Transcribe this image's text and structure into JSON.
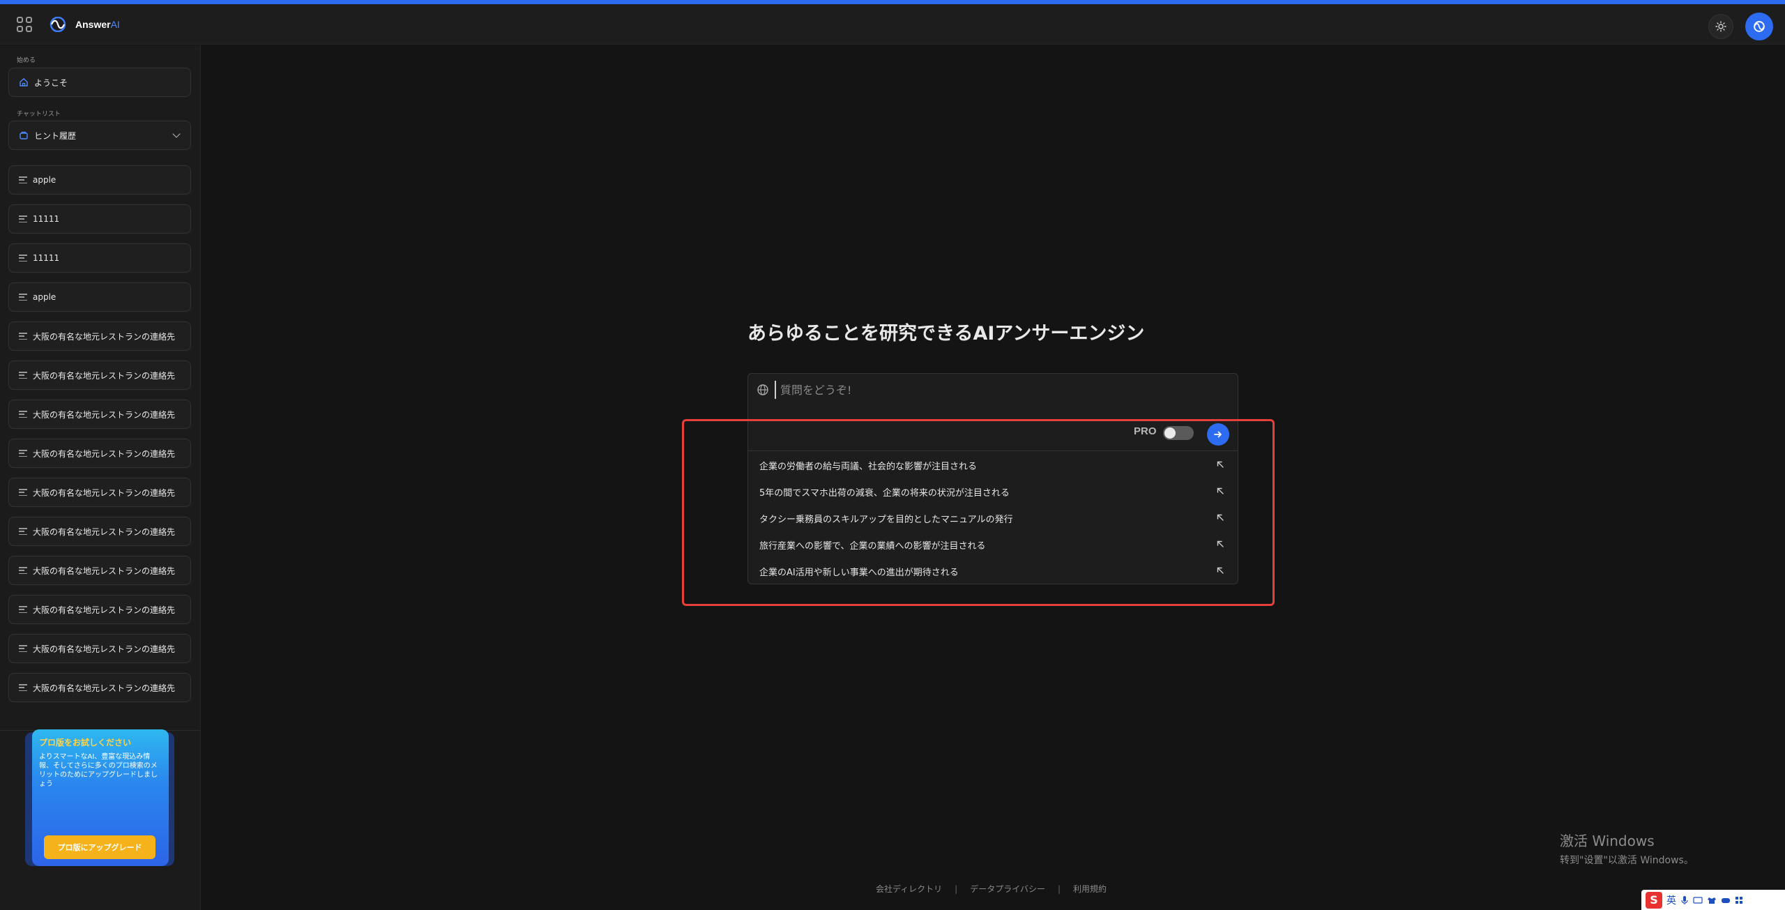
{
  "header": {
    "logo_main": "Answer",
    "logo_accent": "AI"
  },
  "sidebar": {
    "section_start": "始める",
    "welcome": "ようこそ",
    "section_chats": "チャットリスト",
    "history_dropdown": "ヒント履歴",
    "chats": [
      "apple",
      "11111",
      "11111",
      "apple",
      "大阪の有名な地元レストランの連絡先",
      "大阪の有名な地元レストランの連絡先",
      "大阪の有名な地元レストランの連絡先",
      "大阪の有名な地元レストランの連絡先",
      "大阪の有名な地元レストランの連絡先",
      "大阪の有名な地元レストランの連絡先",
      "大阪の有名な地元レストランの連絡先",
      "大阪の有名な地元レストランの連絡先",
      "大阪の有名な地元レストランの連絡先",
      "大阪の有名な地元レストランの連絡先"
    ],
    "promo": {
      "title": "プロ版をお試しください",
      "body": "よりスマートなAI、豊富な現込み情報、そしてさらに多くのプロ検索のメリットのためにアップグレードしましょう",
      "button": "プロ版にアップグレード"
    }
  },
  "main": {
    "headline": "あらゆることを研究できるAIアンサーエンジン",
    "search_placeholder": "質問をどうぞ!",
    "pro_label": "PRO",
    "pro_enabled": false,
    "suggestions": [
      "企業の労働者の給与両議、社会的な影響が注目される",
      "5年の間でスマホ出荷の減衰、企業の将来の状況が注目される",
      "タクシー乗務員のスキルアップを目的としたマニュアルの発行",
      "旅行産業への影響で、企業の業績への影響が注目される",
      "企業のAI活用や新しい事業への進出が期待される"
    ]
  },
  "footer": {
    "links": [
      "会社ディレクトリ",
      "データプライバシー",
      "利用規約"
    ],
    "separator": "|"
  },
  "os_overlay": {
    "activate_title": "激活 Windows",
    "activate_sub": "转到\"设置\"以激活 Windows。",
    "ime_mode": "英"
  },
  "colors": {
    "accent": "#2d6cf0",
    "highlight": "#e5403b",
    "promo_title": "#ffd34a",
    "promo_button": "#f6b21a"
  },
  "icons": [
    "grid-icon",
    "logo-icon",
    "sun-icon",
    "avatar-icon",
    "home-icon",
    "history-icon",
    "chat-lines-icon",
    "chevron-down-icon",
    "globe-icon",
    "arrow-right-icon",
    "arrow-up-left-icon"
  ]
}
